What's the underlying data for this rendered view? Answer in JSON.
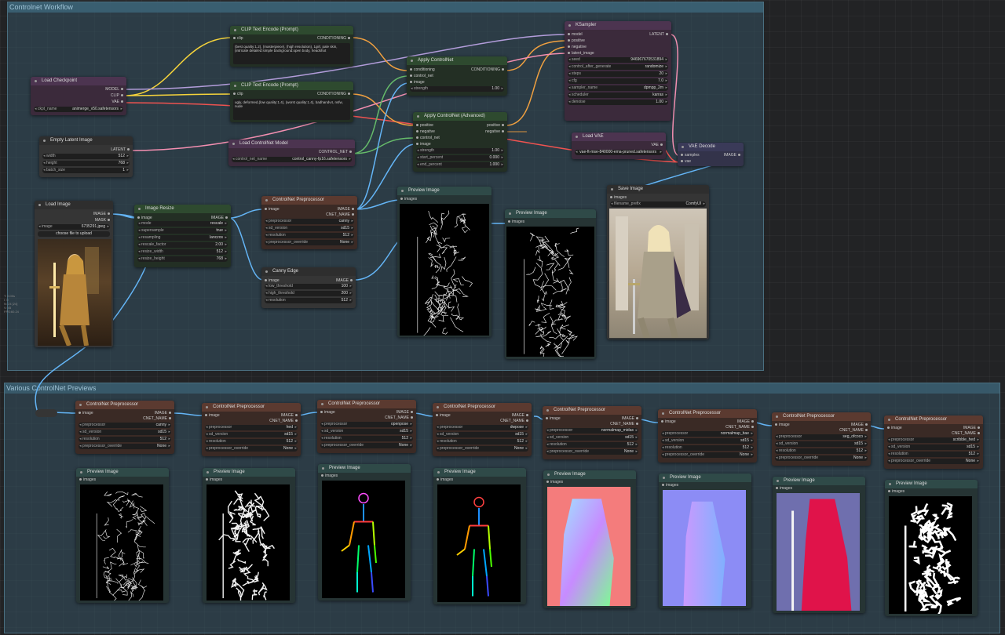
{
  "groups": {
    "workflow_title": "Controlnet Workflow",
    "previews_title": "Various ControlNet Previews"
  },
  "side_info": [
    "T: 0.00s",
    "I: 0",
    "N: 24 [24]",
    "V: 45",
    "FPS:60.24"
  ],
  "load_checkpoint": {
    "title": "Load Checkpoint",
    "outs": [
      "MODEL",
      "CLIP",
      "VAE"
    ],
    "ckpt_label": "ckpt_name",
    "ckpt_value": "animerge_v50.safetensors"
  },
  "clip_pos": {
    "title": "CLIP Text Encode (Prompt)",
    "in": "clip",
    "out": "CONDITIONING",
    "text": "(best quality:1.2), (masterpiece), (high resolution), 1girl, pale skin, (intricate detailed:simple background:open body, headshot"
  },
  "clip_neg": {
    "title": "CLIP Text Encode (Prompt)",
    "in": "clip",
    "out": "CONDITIONING",
    "text": "ugly, deformed,(low quality:1.4), (worst quality:1.4), badhandv4, nsfw, nude"
  },
  "empty_latent": {
    "title": "Empty Latent Image",
    "out": "LATENT",
    "width_label": "width",
    "width": "512",
    "height_label": "height",
    "height": "768",
    "batch_label": "batch_size",
    "batch": "1"
  },
  "load_cn_model": {
    "title": "Load ControlNet Model",
    "out": "CONTROL_NET",
    "label": "control_net_name",
    "value": "control_canny-fp16.safetensors"
  },
  "apply_cn": {
    "title": "Apply ControlNet",
    "ins": [
      "conditioning",
      "control_net",
      "image"
    ],
    "out": "CONDITIONING",
    "strength_label": "strength",
    "strength": "1.00"
  },
  "apply_cn_adv": {
    "title": "Apply ControlNet (Advanced)",
    "ins": [
      "positive",
      "negative",
      "control_net",
      "image"
    ],
    "outs": [
      "positive",
      "negative"
    ],
    "strength_label": "strength",
    "strength": "1.00",
    "start_label": "start_percent",
    "start": "0.000",
    "end_label": "end_percent",
    "end": "1.000"
  },
  "ksampler": {
    "title": "KSampler",
    "ins": [
      "model",
      "positive",
      "negative",
      "latent_image"
    ],
    "out": "LATENT",
    "widgets": [
      [
        "seed",
        "946967670531894"
      ],
      [
        "control_after_generate",
        "randomize"
      ],
      [
        "steps",
        "20"
      ],
      [
        "cfg",
        "7.0"
      ],
      [
        "sampler_name",
        "dpmpp_2m"
      ],
      [
        "scheduler",
        "karras"
      ],
      [
        "denoise",
        "1.00"
      ]
    ]
  },
  "load_vae": {
    "title": "Load VAE",
    "out": "VAE",
    "value": "vae-ft-mse-840000-ema-pruned.safetensors"
  },
  "vae_decode": {
    "title": "VAE Decode",
    "ins": [
      "samples",
      "vae"
    ],
    "out": "IMAGE"
  },
  "load_image": {
    "title": "Load Image",
    "outs": [
      "IMAGE",
      "MASK"
    ],
    "label": "image",
    "value": "6735291.jpeg",
    "button": "choose file to upload"
  },
  "image_resize": {
    "title": "Image Resize",
    "in": "image",
    "out": "IMAGE",
    "widgets": [
      [
        "mode",
        "rescale"
      ],
      [
        "supersample",
        "true"
      ],
      [
        "resampling",
        "lanczos"
      ],
      [
        "rescale_factor",
        "2.00"
      ],
      [
        "resize_width",
        "512"
      ],
      [
        "resize_height",
        "768"
      ]
    ]
  },
  "cn_pre_main": {
    "title": "ControlNet Preprocessor",
    "in": "image",
    "outs": [
      "IMAGE",
      "CNET_NAME"
    ],
    "widgets": [
      [
        "preprocessor",
        "canny"
      ],
      [
        "sd_version",
        "sd15"
      ],
      [
        "resolution",
        "512"
      ],
      [
        "preprocessor_override",
        "None"
      ]
    ]
  },
  "canny_edge": {
    "title": "Canny Edge",
    "in": "image",
    "out": "IMAGE",
    "widgets": [
      [
        "low_threshold",
        "100"
      ],
      [
        "high_threshold",
        "200"
      ],
      [
        "resolution",
        "512"
      ]
    ]
  },
  "preview1": {
    "title": "Preview Image",
    "in": "images"
  },
  "preview2": {
    "title": "Preview Image",
    "in": "images"
  },
  "save_image": {
    "title": "Save Image",
    "in": "images",
    "label": "filename_prefix",
    "value": "ComfyUI"
  },
  "bottom": [
    {
      "pre": "canny",
      "ver": "sd15",
      "res": "512",
      "ovr": "None",
      "art": "lines"
    },
    {
      "pre": "hed",
      "ver": "sd15",
      "res": "512",
      "ovr": "None",
      "art": "hed"
    },
    {
      "pre": "openpose",
      "ver": "sd15",
      "res": "512",
      "ovr": "None",
      "art": "pose"
    },
    {
      "pre": "dwpose",
      "ver": "sd15",
      "res": "512",
      "ovr": "None",
      "art": "pose2"
    },
    {
      "pre": "normalmap_midas",
      "ver": "sd15",
      "res": "512",
      "ovr": "None",
      "art": "normal1"
    },
    {
      "pre": "normalmap_bae",
      "ver": "sd15",
      "res": "512",
      "ovr": "None",
      "art": "normal2"
    },
    {
      "pre": "seg_ofcoco",
      "ver": "sd15",
      "res": "512",
      "ovr": "None",
      "art": "seg"
    },
    {
      "pre": "scribble_hed",
      "ver": "sd15",
      "res": "512",
      "ovr": "None",
      "art": "scribble"
    }
  ],
  "bottom_labels": {
    "pre_title": "ControlNet Preprocessor",
    "prev_title": "Preview Image",
    "in": "image",
    "out1": "IMAGE",
    "out2": "CNET_NAME",
    "l_pre": "preprocessor",
    "l_ver": "sd_version",
    "l_res": "resolution",
    "l_ovr": "preprocessor_override",
    "prev_in": "images"
  }
}
